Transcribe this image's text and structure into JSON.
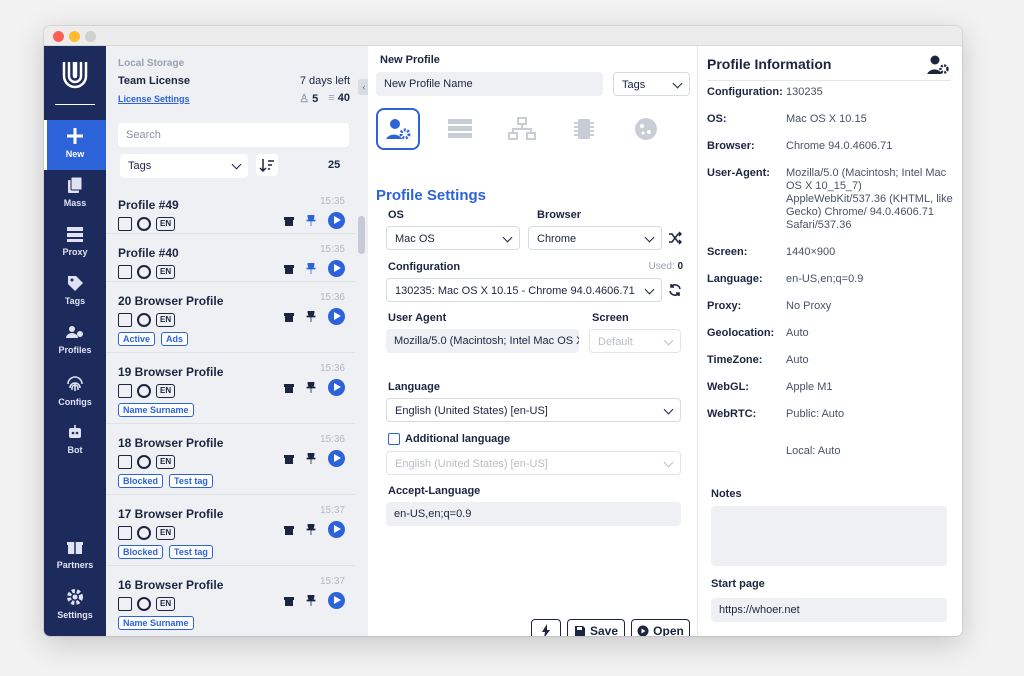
{
  "nav": {
    "items": [
      {
        "label": "New",
        "icon": "plus-icon"
      },
      {
        "label": "Mass",
        "icon": "files-icon"
      },
      {
        "label": "Proxy",
        "icon": "server-icon"
      },
      {
        "label": "Tags",
        "icon": "tag-icon"
      },
      {
        "label": "Profiles",
        "icon": "users-icon"
      },
      {
        "label": "Configs",
        "icon": "fingerprint-icon"
      },
      {
        "label": "Bot",
        "icon": "robot-icon"
      }
    ],
    "bottom": [
      {
        "label": "Partners",
        "icon": "gift-icon"
      },
      {
        "label": "Settings",
        "icon": "gear-icon"
      }
    ]
  },
  "list": {
    "storage": "Local Storage",
    "license": "Team License",
    "days_left": "7 days left",
    "license_settings": "License Settings",
    "members": "5",
    "profiles_limit": "40",
    "search_placeholder": "Search",
    "tags_filter": "Tags",
    "count": "25",
    "profiles": [
      {
        "name": "Profile #49",
        "time": "15:35",
        "lang": "EN",
        "tags": []
      },
      {
        "name": "Profile #40",
        "time": "15:35",
        "lang": "EN",
        "tags": []
      },
      {
        "name": "20 Browser Profile",
        "time": "15:36",
        "lang": "EN",
        "tags": [
          "Active",
          "Ads"
        ]
      },
      {
        "name": "19 Browser Profile",
        "time": "15:36",
        "lang": "EN",
        "tags": [
          "Name Surname"
        ]
      },
      {
        "name": "18 Browser Profile",
        "time": "15:36",
        "lang": "EN",
        "tags": [
          "Blocked",
          "Test tag"
        ]
      },
      {
        "name": "17 Browser Profile",
        "time": "15:37",
        "lang": "EN",
        "tags": [
          "Blocked",
          "Test tag"
        ]
      },
      {
        "name": "16 Browser Profile",
        "time": "15:37",
        "lang": "EN",
        "tags": [
          "Name Surname"
        ]
      }
    ]
  },
  "form": {
    "title": "New Profile",
    "name_value": "New Profile Name",
    "tags": "Tags",
    "section": "Profile Settings",
    "os_label": "OS",
    "os_value": "Mac OS",
    "browser_label": "Browser",
    "browser_value": "Chrome",
    "config_label": "Configuration",
    "used_label": "Used:",
    "used_value": "0",
    "config_value": "130235: Mac OS X 10.15 - Chrome 94.0.4606.71",
    "ua_label": "User Agent",
    "ua_value": "Mozilla/5.0 (Macintosh; Intel Mac OS X 10_15_7)",
    "screen_label": "Screen",
    "screen_value": "Default",
    "language_label": "Language",
    "language_value": "English (United States) [en-US]",
    "additional_label": "Additional language",
    "additional_value": "English (United States) [en-US]",
    "accept_label": "Accept-Language",
    "accept_value": "en-US,en;q=0.9",
    "save": "Save",
    "open": "Open"
  },
  "info": {
    "title": "Profile Information",
    "rows": [
      {
        "k": "Configuration:",
        "v": "130235"
      },
      {
        "k": "OS:",
        "v": "Mac OS X 10.15"
      },
      {
        "k": "Browser:",
        "v": "Chrome 94.0.4606.71"
      },
      {
        "k": "User-Agent:",
        "v": "Mozilla/5.0 (Macintosh; Intel Mac OS X 10_15_7) AppleWebKit/537.36 (KHTML, like Gecko) Chrome/ 94.0.4606.71 Safari/537.36"
      },
      {
        "k": "Screen:",
        "v": "1440×900"
      },
      {
        "k": "Language:",
        "v": "en-US,en;q=0.9"
      },
      {
        "k": "Proxy:",
        "v": "No Proxy"
      },
      {
        "k": "Geolocation:",
        "v": "Auto"
      },
      {
        "k": "TimeZone:",
        "v": "Auto"
      },
      {
        "k": "WebGL:",
        "v": "Apple M1"
      },
      {
        "k": "WebRTC:",
        "v": "Public: Auto"
      }
    ],
    "webrtc_local": "Local:  Auto",
    "notes_label": "Notes",
    "start_label": "Start page",
    "start_value": "https://whoer.net"
  },
  "colors": {
    "accent": "#2d63d8",
    "nav_bg": "#1d2a5c"
  }
}
